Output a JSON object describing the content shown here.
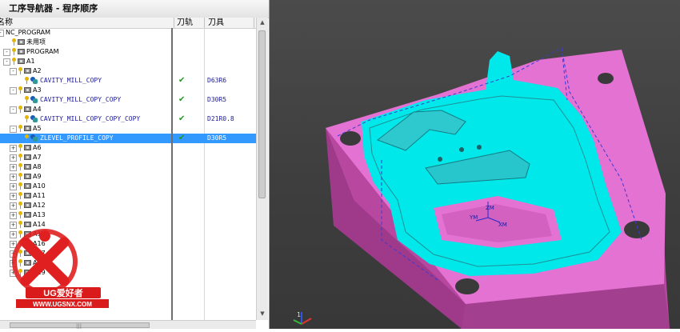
{
  "navigator": {
    "title": "工序导航器 - 程序顺序",
    "columns": {
      "name": "名称",
      "toolpath": "刀轨",
      "tool": "刀具",
      "extra": "刀"
    },
    "rows": [
      {
        "indent": 0,
        "toggle": "-",
        "type": "root",
        "label": "NC_PROGRAM",
        "check": "",
        "tool": ""
      },
      {
        "indent": 1,
        "toggle": "",
        "type": "folder",
        "label": "未用项",
        "check": "",
        "tool": ""
      },
      {
        "indent": 1,
        "toggle": "-",
        "type": "group",
        "label": "PROGRAM",
        "check": "",
        "tool": ""
      },
      {
        "indent": 1,
        "toggle": "-",
        "type": "group",
        "label": "A1",
        "check": "",
        "tool": ""
      },
      {
        "indent": 2,
        "toggle": "-",
        "type": "group",
        "label": "A2",
        "check": "",
        "tool": ""
      },
      {
        "indent": 3,
        "toggle": "",
        "type": "op",
        "label": "CAVITY_MILL_COPY",
        "check": "✔",
        "tool": "D63R6"
      },
      {
        "indent": 2,
        "toggle": "-",
        "type": "group",
        "label": "A3",
        "check": "",
        "tool": ""
      },
      {
        "indent": 3,
        "toggle": "",
        "type": "op",
        "label": "CAVITY_MILL_COPY_COPY",
        "check": "✔",
        "tool": "D30R5"
      },
      {
        "indent": 2,
        "toggle": "-",
        "type": "group",
        "label": "A4",
        "check": "",
        "tool": ""
      },
      {
        "indent": 3,
        "toggle": "",
        "type": "op",
        "label": "CAVITY_MILL_COPY_COPY_COPY",
        "check": "✔",
        "tool": "D21R0.8"
      },
      {
        "indent": 2,
        "toggle": "-",
        "type": "group",
        "label": "A5",
        "check": "",
        "tool": ""
      },
      {
        "indent": 3,
        "toggle": "",
        "type": "op",
        "label": "ZLEVEL_PROFILE_COPY",
        "check": "✔",
        "tool": "D30R5",
        "selected": true
      },
      {
        "indent": 2,
        "toggle": "+",
        "type": "group",
        "label": "A6",
        "check": "",
        "tool": ""
      },
      {
        "indent": 2,
        "toggle": "+",
        "type": "group",
        "label": "A7",
        "check": "",
        "tool": ""
      },
      {
        "indent": 2,
        "toggle": "+",
        "type": "group",
        "label": "A8",
        "check": "",
        "tool": ""
      },
      {
        "indent": 2,
        "toggle": "+",
        "type": "group",
        "label": "A9",
        "check": "",
        "tool": ""
      },
      {
        "indent": 2,
        "toggle": "+",
        "type": "group",
        "label": "A10",
        "check": "",
        "tool": ""
      },
      {
        "indent": 2,
        "toggle": "+",
        "type": "group",
        "label": "A11",
        "check": "",
        "tool": ""
      },
      {
        "indent": 2,
        "toggle": "+",
        "type": "group",
        "label": "A12",
        "check": "",
        "tool": ""
      },
      {
        "indent": 2,
        "toggle": "+",
        "type": "group",
        "label": "A13",
        "check": "",
        "tool": ""
      },
      {
        "indent": 2,
        "toggle": "+",
        "type": "group",
        "label": "A14",
        "check": "",
        "tool": ""
      },
      {
        "indent": 2,
        "toggle": "+",
        "type": "group",
        "label": "A15",
        "check": "",
        "tool": ""
      },
      {
        "indent": 2,
        "toggle": "+",
        "type": "group",
        "label": "A16",
        "check": "",
        "tool": ""
      },
      {
        "indent": 2,
        "toggle": "+",
        "type": "group",
        "label": "A17",
        "check": "",
        "tool": ""
      },
      {
        "indent": 2,
        "toggle": "+",
        "type": "group",
        "label": "A18",
        "check": "",
        "tool": ""
      },
      {
        "indent": 2,
        "toggle": "+",
        "type": "group",
        "label": "A19",
        "check": "",
        "tool": ""
      }
    ]
  },
  "logo": {
    "brand": "UG爱好者",
    "url": "WWW.UGSNX.COM"
  },
  "viewport": {
    "axis_labels": {
      "zm": "ZM",
      "ym": "YM",
      "xm": "XM",
      "corner": "1"
    }
  },
  "colors": {
    "selection": "#3399ff",
    "part_pink": "#e472d2",
    "toolpath_cyan": "#00e8ea",
    "viewport_bg": "#444444",
    "check_green": "#1e9b1e"
  }
}
